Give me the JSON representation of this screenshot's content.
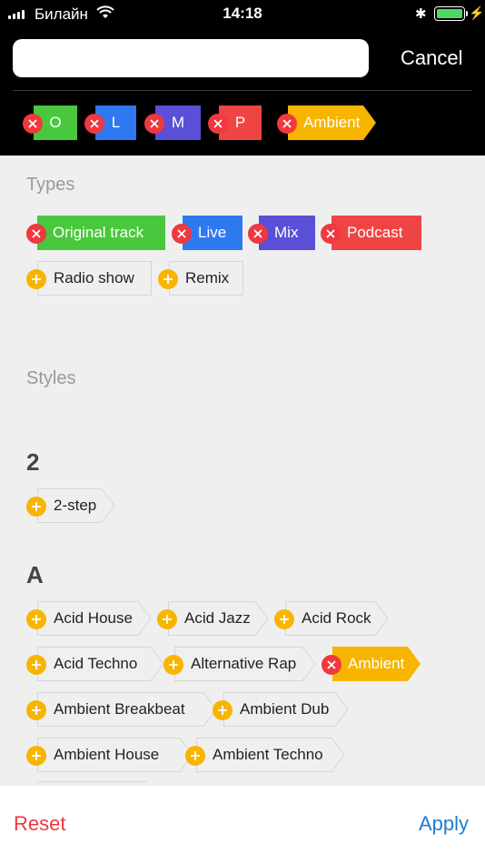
{
  "status_bar": {
    "carrier": "Билайн",
    "time": "14:18"
  },
  "search": {
    "value": "",
    "cancel_label": "Cancel"
  },
  "selected_filters": [
    {
      "label": "O",
      "color": "#4ac83d"
    },
    {
      "label": "L",
      "color": "#2f79f0"
    },
    {
      "label": "M",
      "color": "#5a4fd6"
    },
    {
      "label": "P",
      "color": "#ef4444"
    },
    {
      "label": "Ambient",
      "color": "#f7b500"
    }
  ],
  "types": {
    "heading": "Types",
    "items": [
      {
        "label": "Original track",
        "selected": true,
        "color": "#4ac83d"
      },
      {
        "label": "Live",
        "selected": true,
        "color": "#2f79f0"
      },
      {
        "label": "Mix",
        "selected": true,
        "color": "#5a4fd6"
      },
      {
        "label": "Podcast",
        "selected": true,
        "color": "#ef4444"
      },
      {
        "label": "Radio show",
        "selected": false
      },
      {
        "label": "Remix",
        "selected": false
      }
    ]
  },
  "styles": {
    "heading": "Styles",
    "groups": [
      {
        "letter": "2",
        "items": [
          {
            "label": "2-step",
            "selected": false
          }
        ]
      },
      {
        "letter": "A",
        "items": [
          {
            "label": "Acid House",
            "selected": false
          },
          {
            "label": "Acid Jazz",
            "selected": false
          },
          {
            "label": "Acid Rock",
            "selected": false
          },
          {
            "label": "Acid Techno",
            "selected": false
          },
          {
            "label": "Alternative Rap",
            "selected": false
          },
          {
            "label": "Ambient",
            "selected": true,
            "color": "#f7b500"
          },
          {
            "label": "Ambient Breakbeat",
            "selected": false
          },
          {
            "label": "Ambient Dub",
            "selected": false
          },
          {
            "label": "Ambient House",
            "selected": false
          },
          {
            "label": "Ambient Techno",
            "selected": false
          }
        ]
      }
    ]
  },
  "footer": {
    "reset_label": "Reset",
    "apply_label": "Apply"
  }
}
